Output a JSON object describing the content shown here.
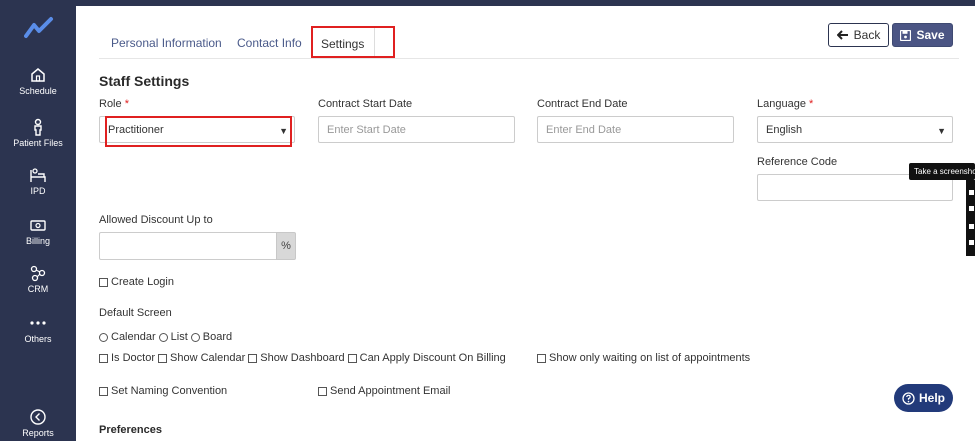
{
  "sidebar": {
    "items": [
      {
        "label": "Schedule",
        "icon": "home-icon"
      },
      {
        "label": "Patient Files",
        "icon": "person-icon"
      },
      {
        "label": "IPD",
        "icon": "bed-icon"
      },
      {
        "label": "Billing",
        "icon": "billing-icon"
      },
      {
        "label": "CRM",
        "icon": "crm-icon"
      },
      {
        "label": "Others",
        "icon": "more-icon"
      },
      {
        "label": "Reports",
        "icon": "reports-icon"
      }
    ]
  },
  "tabs": [
    {
      "label": "Personal Information"
    },
    {
      "label": "Contact Info"
    },
    {
      "label": "Settings",
      "active": true
    }
  ],
  "toolbar": {
    "back_label": "Back",
    "save_label": "Save"
  },
  "section_title": "Staff Settings",
  "fields": {
    "role": {
      "label": "Role",
      "required": "*",
      "value": "Practitioner"
    },
    "contract_start": {
      "label": "Contract Start Date",
      "placeholder": "Enter Start Date"
    },
    "contract_end": {
      "label": "Contract End Date",
      "placeholder": "Enter End Date"
    },
    "language": {
      "label": "Language",
      "required": "*",
      "value": "English"
    },
    "reference_code": {
      "label": "Reference Code",
      "value": ""
    },
    "allowed_discount": {
      "label": "Allowed Discount Up to",
      "value": "",
      "suffix": "%"
    }
  },
  "create_login": {
    "label": "Create Login",
    "checked": false
  },
  "default_screen": {
    "label": "Default Screen",
    "options": [
      "Calendar",
      "List",
      "Board"
    ]
  },
  "checkboxes_row": [
    {
      "label": "Is Doctor"
    },
    {
      "label": "Show Calendar"
    },
    {
      "label": "Show Dashboard"
    },
    {
      "label": "Can Apply Discount On Billing"
    },
    {
      "label": "Show only waiting on list of appointments"
    }
  ],
  "checkboxes_row2": [
    {
      "label": "Set Naming Convention"
    },
    {
      "label": "Send Appointment Email"
    }
  ],
  "preferences_title": "Preferences",
  "tooltip_text": "Take a screenshot",
  "help_label": "Help",
  "colors": {
    "sidebar": "#2c3450",
    "save": "#4b5584",
    "help": "#223a7a",
    "highlight": "#e02020"
  }
}
